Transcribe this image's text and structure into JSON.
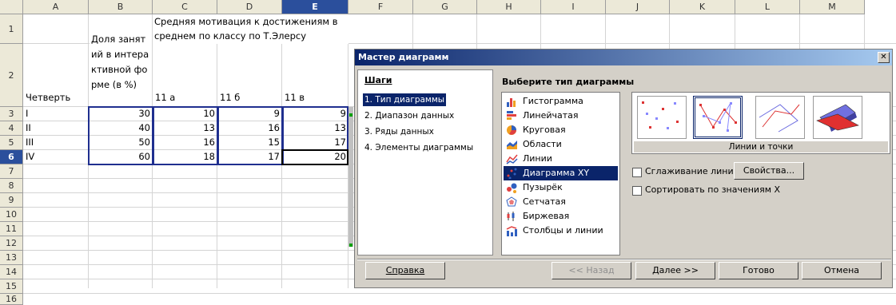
{
  "sheet": {
    "columns": [
      "A",
      "B",
      "C",
      "D",
      "E",
      "F",
      "G",
      "H",
      "I",
      "J",
      "K",
      "L",
      "M"
    ],
    "rows": [
      "1",
      "2",
      "3",
      "4",
      "5",
      "6",
      "7",
      "8",
      "9",
      "10",
      "11",
      "12",
      "13",
      "14",
      "15",
      "16"
    ],
    "c1_header": "Средняя мотивация к достижениям в среднем по классу по Т.Элерсу",
    "a2": "Четверть",
    "b2": "Доля занятий в интерактивной форме (в %)",
    "c2": "11 а",
    "d2": "11 б",
    "e2": "11 в",
    "data_rows": [
      {
        "q": "I",
        "share": "30",
        "a": "10",
        "b": "9",
        "c": "9"
      },
      {
        "q": "II",
        "share": "40",
        "a": "13",
        "b": "16",
        "c": "13"
      },
      {
        "q": "III",
        "share": "50",
        "a": "16",
        "b": "15",
        "c": "17"
      },
      {
        "q": "IV",
        "share": "60",
        "a": "18",
        "b": "17",
        "c": "20"
      }
    ]
  },
  "dialog": {
    "title": "Мастер диаграмм",
    "close": "✕",
    "steps_title": "Шаги",
    "steps": [
      "1. Тип диаграммы",
      "2. Диапазон данных",
      "3. Ряды данных",
      "4. Элементы диаграммы"
    ],
    "choose_type": "Выберите тип диаграммы",
    "types": [
      "Гистограмма",
      "Линейчатая",
      "Круговая",
      "Области",
      "Линии",
      "Диаграмма XY",
      "Пузырёк",
      "Сетчатая",
      "Биржевая",
      "Столбцы и линии"
    ],
    "type_icons": [
      "bar-chart-icon",
      "hbar-chart-icon",
      "pie-chart-icon",
      "area-chart-icon",
      "line-chart-icon",
      "xy-chart-icon",
      "bubble-chart-icon",
      "net-chart-icon",
      "stock-chart-icon",
      "column-line-chart-icon"
    ],
    "variant_label": "Линии и точки",
    "smooth_label": "Сглаживание линий",
    "properties_btn": "Свойства...",
    "sort_label": "Сортировать по значениям X",
    "buttons": {
      "help": "Справка",
      "back": "<< Назад",
      "next": "Далее >>",
      "finish": "Готово",
      "cancel": "Отмена"
    },
    "accent": "#0a246a"
  }
}
